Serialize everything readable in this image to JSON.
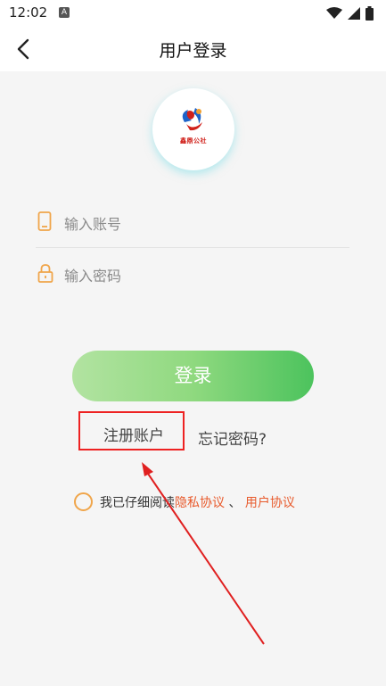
{
  "status_bar": {
    "time": "12:02",
    "notification_letter": "A"
  },
  "header": {
    "title": "用户登录"
  },
  "logo": {
    "text": "鑫鼎公社"
  },
  "form": {
    "account_placeholder": "输入账号",
    "password_placeholder": "输入密码"
  },
  "actions": {
    "login_label": "登录",
    "register_label": "注册账户",
    "forgot_label": "忘记密码?"
  },
  "agreement": {
    "prefix": "我已仔细阅读",
    "privacy_link": "隐私协议",
    "separator": "、",
    "user_link": "用户协议"
  },
  "colors": {
    "accent_orange": "#f0a54a",
    "link": "#e85a2c",
    "highlight_red": "#e22222",
    "button_green": "#4cc35d"
  }
}
